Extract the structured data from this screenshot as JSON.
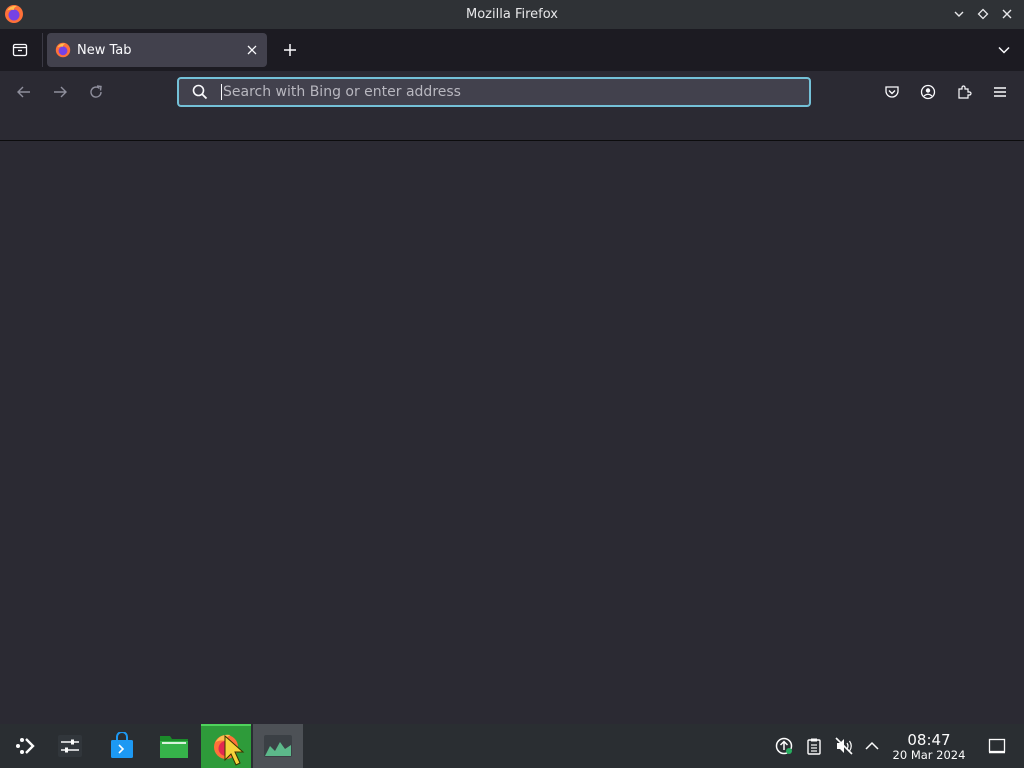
{
  "window": {
    "title": "Mozilla Firefox",
    "controls": [
      "minimize",
      "maximize",
      "close"
    ]
  },
  "tabs": [
    {
      "title": "New Tab",
      "active": true
    }
  ],
  "navbar": {
    "search_placeholder": "Search with Bing or enter address",
    "search_value": ""
  },
  "colors": {
    "accent": "#74c1d8",
    "toolbar": "#2b2a33",
    "tabstrip": "#1c1b22",
    "active_tab": "#42414d",
    "taskbar": "#2a2e32",
    "taskbar_active": "#2e9b3a"
  },
  "taskbar": {
    "apps": [
      {
        "name": "application-launcher",
        "icon": "kde-launcher-icon"
      },
      {
        "name": "system-settings",
        "icon": "settings-sliders-icon"
      },
      {
        "name": "discover",
        "icon": "shopping-bag-icon"
      },
      {
        "name": "files",
        "icon": "folder-icon"
      },
      {
        "name": "firefox",
        "icon": "firefox-icon",
        "active": true
      },
      {
        "name": "system-monitor",
        "icon": "monitor-graph-icon"
      }
    ],
    "tray": [
      "updates-icon",
      "clipboard-icon",
      "volume-muted-icon",
      "tray-expand-icon"
    ],
    "clock": {
      "time": "08:47",
      "date": "20 Mar 2024"
    }
  }
}
